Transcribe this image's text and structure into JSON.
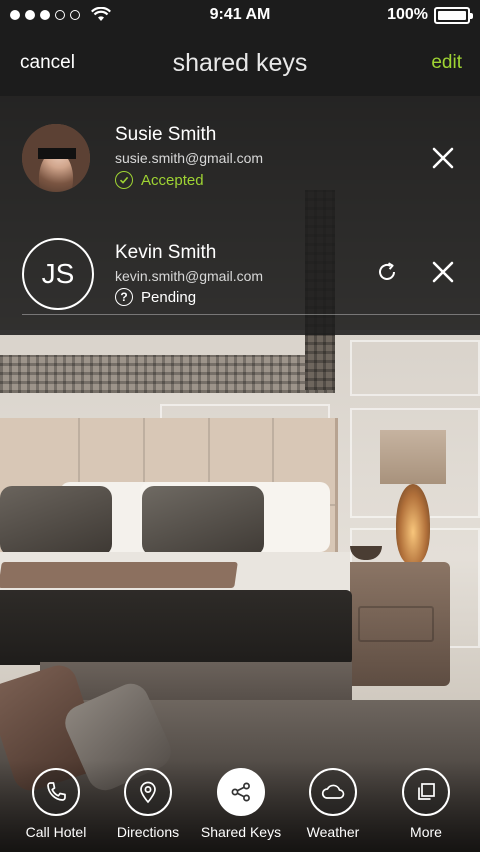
{
  "status_bar": {
    "time": "9:41 AM",
    "battery": "100%",
    "signal_bars_filled": 3,
    "signal_bars_total": 5
  },
  "nav": {
    "cancel_label": "cancel",
    "title": "shared keys",
    "edit_label": "edit"
  },
  "keys": [
    {
      "name": "Susie Smith",
      "email": "susie.smith@gmail.com",
      "status": "Accepted",
      "avatar": "photo"
    },
    {
      "name": "Kevin Smith",
      "email": "kevin.smith@gmail.com",
      "status": "Pending",
      "initials": "JS"
    }
  ],
  "tabs": [
    {
      "label": "Call Hotel",
      "icon": "phone-icon",
      "active": false
    },
    {
      "label": "Directions",
      "icon": "map-pin-icon",
      "active": false
    },
    {
      "label": "Shared Keys",
      "icon": "share-icon",
      "active": true
    },
    {
      "label": "Weather",
      "icon": "cloud-icon",
      "active": false
    },
    {
      "label": "More",
      "icon": "stacked-squares-icon",
      "active": false
    }
  ],
  "colors": {
    "accent_green": "#9fd433",
    "bar_background": "#1c1c1c",
    "text": "#ffffff"
  }
}
